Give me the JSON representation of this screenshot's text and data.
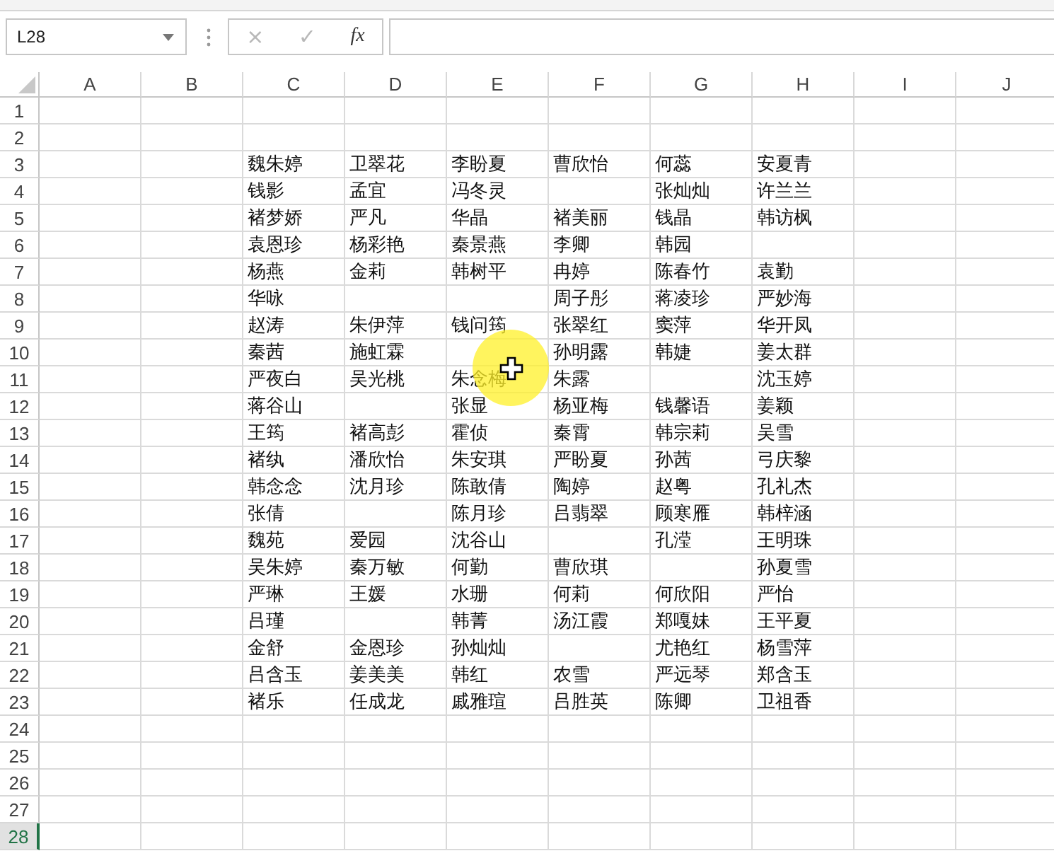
{
  "name_box": {
    "value": "L28"
  },
  "formula_buttons": [
    {
      "label": "×",
      "disabled": true
    },
    {
      "label": "✓",
      "disabled": true
    },
    {
      "label": "fx"
    }
  ],
  "columns": [
    "A",
    "B",
    "C",
    "D",
    "E",
    "F",
    "G",
    "H",
    "I",
    "J"
  ],
  "rows": [
    {
      "number": "1",
      "selected": false
    },
    {
      "number": "2",
      "selected": false
    },
    {
      "number": "3",
      "selected": false,
      "cells": [
        null,
        null,
        "魏朱婷",
        "卫翠花",
        "李盼夏",
        "曹欣怡",
        "何蕊",
        "安夏青"
      ]
    },
    {
      "number": "4",
      "selected": false,
      "cells": [
        null,
        null,
        "钱影",
        "孟宜",
        "冯冬灵",
        null,
        "张灿灿",
        "许兰兰"
      ]
    },
    {
      "number": "5",
      "selected": false,
      "cells": [
        null,
        null,
        "褚梦娇",
        "严凡",
        "华晶",
        "褚美丽",
        "钱晶",
        "韩访枫"
      ]
    },
    {
      "number": "6",
      "selected": false,
      "cells": [
        null,
        null,
        "袁恩珍",
        "杨彩艳",
        "秦景燕",
        "李卿",
        "韩园",
        null
      ]
    },
    {
      "number": "7",
      "selected": false,
      "cells": [
        null,
        null,
        "杨燕",
        "金莉",
        "韩树平",
        "冉婷",
        "陈春竹",
        "袁勤"
      ]
    },
    {
      "number": "8",
      "selected": false,
      "cells": [
        null,
        null,
        "华咏",
        null,
        null,
        "周子彤",
        "蒋凌珍",
        "严妙海"
      ]
    },
    {
      "number": "9",
      "selected": false,
      "cells": [
        null,
        null,
        "赵涛",
        "朱伊萍",
        "钱问筠",
        "张翠红",
        "窦萍",
        "华开凤"
      ]
    },
    {
      "number": "10",
      "selected": false,
      "cells": [
        null,
        null,
        "秦茜",
        "施虹霖",
        null,
        "孙明露",
        "韩婕",
        "姜太群"
      ]
    },
    {
      "number": "11",
      "selected": false,
      "cells": [
        null,
        null,
        "严夜白",
        "吴光桃",
        "朱念梅",
        "朱露",
        null,
        "沈玉婷"
      ]
    },
    {
      "number": "12",
      "selected": false,
      "cells": [
        null,
        null,
        "蒋谷山",
        null,
        "张显",
        "杨亚梅",
        "钱馨语",
        "姜颖"
      ]
    },
    {
      "number": "13",
      "selected": false,
      "cells": [
        null,
        null,
        "王筠",
        "褚高彭",
        "霍侦",
        "秦霄",
        "韩宗莉",
        "吴雪"
      ]
    },
    {
      "number": "14",
      "selected": false,
      "cells": [
        null,
        null,
        "褚纨",
        "潘欣怡",
        "朱安琪",
        "严盼夏",
        "孙茜",
        "弓庆黎"
      ]
    },
    {
      "number": "15",
      "selected": false,
      "cells": [
        null,
        null,
        "韩念念",
        "沈月珍",
        "陈敢倩",
        "陶婷",
        "赵粤",
        "孔礼杰"
      ]
    },
    {
      "number": "16",
      "selected": false,
      "cells": [
        null,
        null,
        "张倩",
        null,
        "陈月珍",
        "吕翡翠",
        "顾寒雁",
        "韩梓涵"
      ]
    },
    {
      "number": "17",
      "selected": false,
      "cells": [
        null,
        null,
        "魏苑",
        "爱园",
        "沈谷山",
        null,
        "孔滢",
        "王明珠"
      ]
    },
    {
      "number": "18",
      "selected": false,
      "cells": [
        null,
        null,
        "吴朱婷",
        "秦万敏",
        "何勤",
        "曹欣琪",
        null,
        "孙夏雪"
      ]
    },
    {
      "number": "19",
      "selected": false,
      "cells": [
        null,
        null,
        "严琳",
        "王媛",
        "水珊",
        "何莉",
        "何欣阳",
        "严怡"
      ]
    },
    {
      "number": "20",
      "selected": false,
      "cells": [
        null,
        null,
        "吕瑾",
        null,
        "韩菁",
        "汤江霞",
        "郑嘎妹",
        "王平夏"
      ]
    },
    {
      "number": "21",
      "selected": false,
      "cells": [
        null,
        null,
        "金舒",
        "金恩珍",
        "孙灿灿",
        null,
        "尤艳红",
        "杨雪萍"
      ]
    },
    {
      "number": "22",
      "selected": false,
      "cells": [
        null,
        null,
        "吕含玉",
        "姜美美",
        "韩红",
        "农雪",
        "严远琴",
        "郑含玉"
      ]
    },
    {
      "number": "23",
      "selected": false,
      "cells": [
        null,
        null,
        "褚乐",
        "任成龙",
        "戚雅瑄",
        "吕胜英",
        "陈卿",
        "卫祖香"
      ]
    },
    {
      "number": "24",
      "selected": false
    },
    {
      "number": "25",
      "selected": false
    },
    {
      "number": "26",
      "selected": false
    },
    {
      "number": "27",
      "selected": false
    },
    {
      "number": "28",
      "selected": true
    }
  ]
}
